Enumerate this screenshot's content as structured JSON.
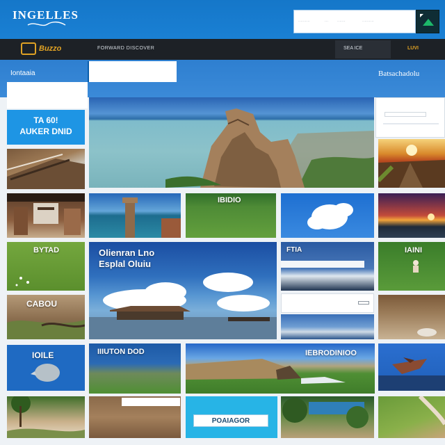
{
  "header": {
    "logo_text": "INGELLES",
    "search_placeholder_segments": [
      "··········",
      "···",
      "·······",
      "··········"
    ],
    "search_icon": "search-icon"
  },
  "nav": {
    "brand": "Buzzo",
    "tagline": "FORWARD DISCOVER",
    "link_1": "SEA ICE",
    "link_2": "LUVI"
  },
  "band": {
    "left_label": "Iontaaia",
    "right_label": "Batsachadolu"
  },
  "promo": {
    "line1": "TA 60!",
    "line2": "AUKER DNID"
  },
  "tiles": {
    "field_caption": "IBIDIO",
    "feature_line1": "Olienran Lno",
    "feature_line2": "Esplal Oluiu",
    "mini_caption": "FTIA",
    "grass_caption": "BYTAD",
    "grass_right_caption": "IAINI",
    "beach_caption": "CABOU",
    "blue_caption": "IOILE",
    "blue_header_caption": "IIIUTON DOD",
    "wide_caption": "IEBRODINIOO",
    "cyan_label": "POAIAGOR"
  },
  "colors": {
    "header_blue": "#1a80d4",
    "nav_dark": "#1d2126",
    "accent_gold": "#e0a224",
    "promo_blue": "#1e95e4",
    "cyan": "#27b4e6"
  }
}
